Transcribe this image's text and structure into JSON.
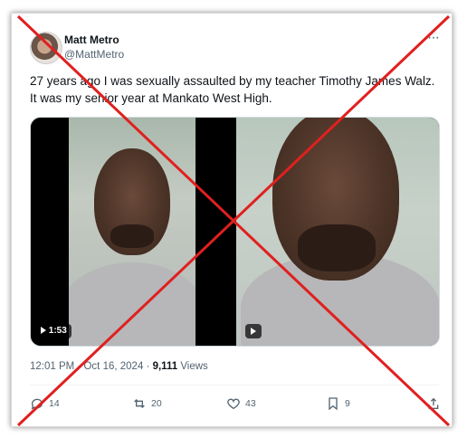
{
  "author": {
    "name": "Matt Metro",
    "handle": "@MattMetro",
    "avatar_icon": "avatar-icon"
  },
  "more_label": "···",
  "tweet_text": "27 years ago I was sexually assaulted by my teacher Timothy James Walz. It was my senior year at Mankato West High.",
  "media": {
    "video1_duration": "1:53",
    "video1_icon": "play-icon",
    "video2_icon": "play-icon"
  },
  "meta": {
    "time": "12:01 PM",
    "separator": "·",
    "date": "Oct 16, 2024",
    "views_count": "9,111",
    "views_label": "Views"
  },
  "actions": {
    "replies": "14",
    "reposts": "20",
    "likes": "43",
    "bookmarks": "9"
  },
  "overlay": {
    "mark": "red-x-cross",
    "color": "#e0201f"
  }
}
